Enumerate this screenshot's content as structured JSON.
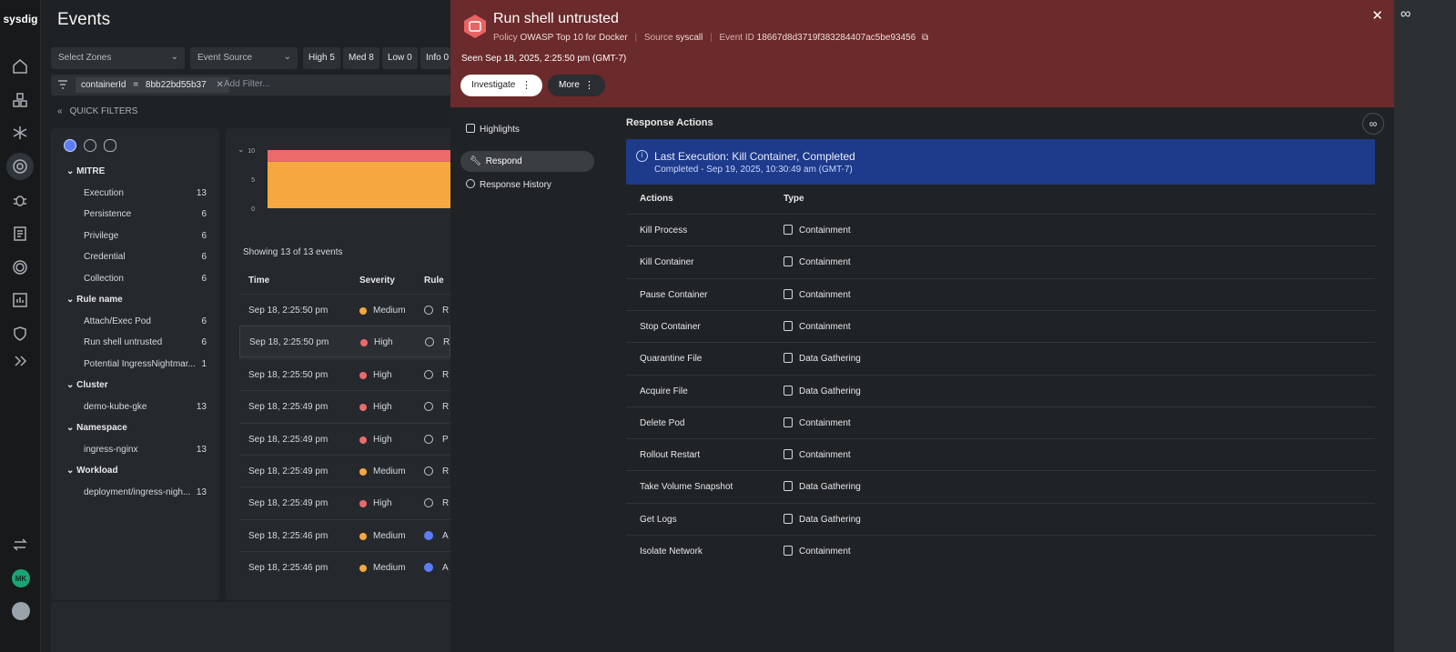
{
  "rail": {
    "logo": "sysdig",
    "avatar_initials": "MK"
  },
  "events": {
    "title": "Events",
    "zones_placeholder": "Select Zones",
    "source_placeholder": "Event Source",
    "severity_pills": [
      "High 5",
      "Med 8",
      "Low 0",
      "Info 0"
    ],
    "filter": {
      "key": "containerId",
      "op": "=",
      "value": "8bb22bd55b37",
      "add_placeholder": "Add Filter..."
    },
    "quick_filters_label": "QUICK FILTERS",
    "groups": [
      {
        "name": "MITRE",
        "items": [
          {
            "label": "Execution",
            "count": "13"
          },
          {
            "label": "Persistence",
            "count": "6"
          },
          {
            "label": "Privilege",
            "count": "6"
          },
          {
            "label": "Credential",
            "count": "6"
          },
          {
            "label": "Collection",
            "count": "6"
          }
        ]
      },
      {
        "name": "Rule name",
        "items": [
          {
            "label": "Attach/Exec Pod",
            "count": "6"
          },
          {
            "label": "Run shell untrusted",
            "count": "6"
          },
          {
            "label": "Potential IngressNightmar...",
            "count": "1"
          }
        ]
      },
      {
        "name": "Cluster",
        "items": [
          {
            "label": "demo-kube-gke",
            "count": "13"
          }
        ]
      },
      {
        "name": "Namespace",
        "items": [
          {
            "label": "ingress-nginx",
            "count": "13"
          }
        ]
      },
      {
        "name": "Workload",
        "items": [
          {
            "label": "deployment/ingress-nigh...",
            "count": "13"
          }
        ]
      }
    ],
    "chart": {
      "ticks": [
        "10",
        "5",
        "0"
      ],
      "high": 3,
      "medium": 8,
      "ymax": 10
    },
    "showing": "Showing 13 of 13 events",
    "columns": [
      "Time",
      "Severity",
      "Rule"
    ],
    "rows": [
      {
        "time": "Sep 18, 2:25:50 pm",
        "severity": "Medium",
        "rule": "R"
      },
      {
        "time": "Sep 18, 2:25:50 pm",
        "severity": "High",
        "rule": "R"
      },
      {
        "time": "Sep 18, 2:25:50 pm",
        "severity": "High",
        "rule": "R"
      },
      {
        "time": "Sep 18, 2:25:49 pm",
        "severity": "High",
        "rule": "R"
      },
      {
        "time": "Sep 18, 2:25:49 pm",
        "severity": "High",
        "rule": "P"
      },
      {
        "time": "Sep 18, 2:25:49 pm",
        "severity": "Medium",
        "rule": "R"
      },
      {
        "time": "Sep 18, 2:25:49 pm",
        "severity": "High",
        "rule": "R"
      },
      {
        "time": "Sep 18, 2:25:46 pm",
        "severity": "Medium",
        "rule": "A"
      },
      {
        "time": "Sep 18, 2:25:46 pm",
        "severity": "Medium",
        "rule": "A"
      }
    ]
  },
  "drawer": {
    "title": "Run shell untrusted",
    "policy_label": "Policy",
    "policy": "OWASP Top 10 for Docker",
    "source_label": "Source",
    "source": "syscall",
    "event_id_label": "Event ID",
    "event_id": "18667d8d3719f383284407ac5be93456",
    "seen": "Seen Sep 18, 2025, 2:25:50 pm (GMT-7)",
    "investigate_label": "Investigate",
    "more_label": "More",
    "nav": {
      "highlights": "Highlights",
      "respond": "Respond",
      "history": "Response History"
    },
    "response_actions_title": "Response Actions",
    "banner_title": "Last Execution: Kill Container, Completed",
    "banner_sub": "Completed - Sep 19, 2025, 10:30:49 am (GMT-7)",
    "columns": [
      "Actions",
      "Type"
    ],
    "actions": [
      {
        "name": "Kill Process",
        "type": "Containment"
      },
      {
        "name": "Kill Container",
        "type": "Containment"
      },
      {
        "name": "Pause Container",
        "type": "Containment"
      },
      {
        "name": "Stop Container",
        "type": "Containment"
      },
      {
        "name": "Quarantine File",
        "type": "Data Gathering"
      },
      {
        "name": "Acquire File",
        "type": "Data Gathering"
      },
      {
        "name": "Delete Pod",
        "type": "Containment"
      },
      {
        "name": "Rollout Restart",
        "type": "Containment"
      },
      {
        "name": "Take Volume Snapshot",
        "type": "Data Gathering"
      },
      {
        "name": "Get Logs",
        "type": "Data Gathering"
      },
      {
        "name": "Isolate Network",
        "type": "Containment"
      }
    ]
  },
  "colors": {
    "high": "#ec6a6a",
    "medium": "#f5a83f",
    "header": "#6b2a2b",
    "banner": "#1e3a8a"
  }
}
